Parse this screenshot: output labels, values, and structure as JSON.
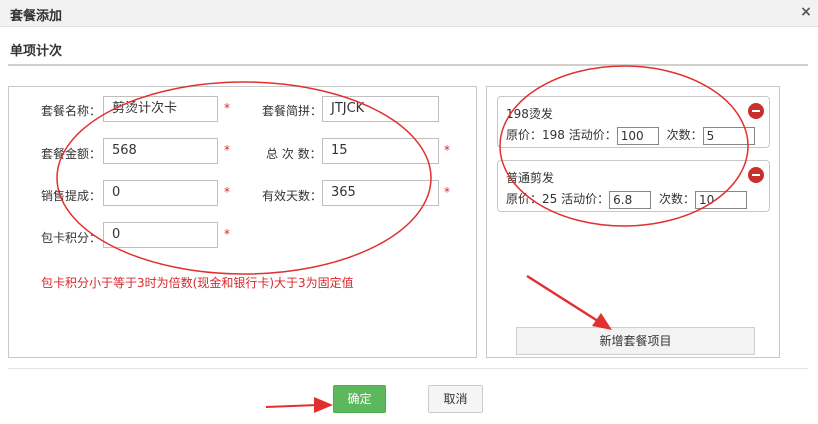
{
  "dialog": {
    "title": "套餐添加",
    "close_glyph": "×"
  },
  "section": {
    "title": "单项计次"
  },
  "form": {
    "required_mark": "*",
    "fields": {
      "name": {
        "label": "套餐名称：",
        "value": "剪烫计次卡"
      },
      "pinyin": {
        "label": "套餐简拼：",
        "value": "JTJCK"
      },
      "amount": {
        "label": "套餐金额：",
        "value": "568"
      },
      "total_times": {
        "label": "总 次 数：",
        "value": "15"
      },
      "commission": {
        "label": "销售提成：",
        "value": "0"
      },
      "valid_days": {
        "label": "有效天数：",
        "value": "365"
      },
      "points": {
        "label": "包卡积分：",
        "value": "0"
      }
    },
    "hint": "包卡积分小于等于3时为倍数(现金和银行卡)大于3为固定值"
  },
  "items": [
    {
      "name": "198烫发",
      "original_label": "原价：198",
      "promo_label": "活动价：",
      "promo_value": "100",
      "times_label": "次数：",
      "times_value": "5"
    },
    {
      "name": "普通剪发",
      "original_label": "原价：25",
      "promo_label": "活动价：",
      "promo_value": "6.8",
      "times_label": "次数：",
      "times_value": "10"
    }
  ],
  "actions": {
    "add_item": "新增套餐项目",
    "confirm": "确定",
    "cancel": "取消"
  },
  "colors": {
    "required": "#d9262b",
    "annotation": "#e03030",
    "confirm": "#5cb85c",
    "remove": "#c9302c"
  },
  "icons": {
    "close": "close-icon",
    "remove": "remove-circle-icon"
  }
}
